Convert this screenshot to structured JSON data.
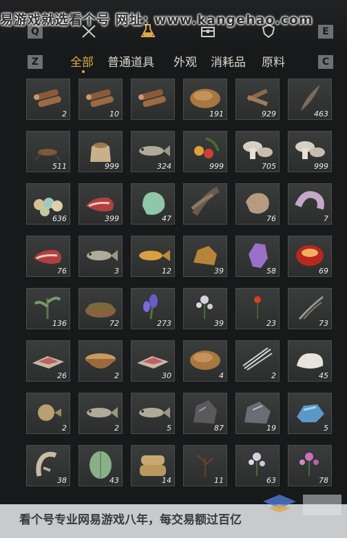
{
  "watermark_top": "易游戏就选看个号  网址: www.kangehao.com",
  "watermark_bottom": "看个号专业网易游戏八年，每交易额过百亿",
  "watermark_url": "www.kangehao.com",
  "keys": {
    "top_left": "Q",
    "top_right": "E",
    "tab_left": "Z",
    "tab_right": "C"
  },
  "top_icons": [
    "crossed-swords-icon",
    "flask-icon",
    "chest-icon",
    "shield-icon"
  ],
  "tabs": [
    {
      "label": "全部",
      "active": true
    },
    {
      "label": "普通道具",
      "active": false
    },
    {
      "label": "外观",
      "active": false
    },
    {
      "label": "消耗品",
      "active": false
    },
    {
      "label": "原料",
      "active": false
    }
  ],
  "items": [
    [
      {
        "icon": "wood-log",
        "count": "2"
      },
      {
        "icon": "wood-log",
        "count": "10"
      },
      {
        "icon": "wood-log",
        "count": ""
      },
      {
        "icon": "fiber-bundle",
        "count": "191"
      },
      {
        "icon": "branch-pile",
        "count": "929"
      },
      {
        "icon": "feather",
        "count": "463"
      }
    ],
    [
      {
        "icon": "cricket",
        "count": "511"
      },
      {
        "icon": "grain-sack",
        "count": "999"
      },
      {
        "icon": "fish",
        "count": "324"
      },
      {
        "icon": "berry-branch",
        "count": "999"
      },
      {
        "icon": "mushroom",
        "count": "705"
      },
      {
        "icon": "mushroom",
        "count": "999"
      }
    ],
    [
      {
        "icon": "eggs",
        "count": "636"
      },
      {
        "icon": "raw-meat",
        "count": "399"
      },
      {
        "icon": "jade-stone",
        "count": "47"
      },
      {
        "icon": "feathers",
        "count": ""
      },
      {
        "icon": "hide",
        "count": "76"
      },
      {
        "icon": "pelt",
        "count": "7"
      }
    ],
    [
      {
        "icon": "raw-meat",
        "count": "76"
      },
      {
        "icon": "fish",
        "count": "3"
      },
      {
        "icon": "golden-carp",
        "count": "12"
      },
      {
        "icon": "ore-chunk",
        "count": "39"
      },
      {
        "icon": "amethyst",
        "count": "58"
      },
      {
        "icon": "red-agate",
        "count": "69"
      }
    ],
    [
      {
        "icon": "herb",
        "count": "136"
      },
      {
        "icon": "herb-bowl",
        "count": "72"
      },
      {
        "icon": "lavender",
        "count": "273"
      },
      {
        "icon": "white-flower",
        "count": "39"
      },
      {
        "icon": "red-flower",
        "count": "23"
      },
      {
        "icon": "dry-grass",
        "count": "73"
      }
    ],
    [
      {
        "icon": "meat-slice",
        "count": "26"
      },
      {
        "icon": "soup-bowl",
        "count": "2"
      },
      {
        "icon": "meat-slice",
        "count": "30"
      },
      {
        "icon": "fiber-bundle",
        "count": "4"
      },
      {
        "icon": "quills",
        "count": "2"
      },
      {
        "icon": "fleece",
        "count": "45"
      }
    ],
    [
      {
        "icon": "pufferfish",
        "count": "2"
      },
      {
        "icon": "fish",
        "count": "2"
      },
      {
        "icon": "fish",
        "count": "5"
      },
      {
        "icon": "iron-ore",
        "count": "87"
      },
      {
        "icon": "silver-ore",
        "count": "19"
      },
      {
        "icon": "blue-crystal",
        "count": "5"
      }
    ],
    [
      {
        "icon": "root",
        "count": "38"
      },
      {
        "icon": "melon",
        "count": "43"
      },
      {
        "icon": "rice-sack",
        "count": "14"
      },
      {
        "icon": "dead-herb",
        "count": "11"
      },
      {
        "icon": "white-flower",
        "count": "63"
      },
      {
        "icon": "purple-flower",
        "count": "78"
      }
    ]
  ],
  "colors": {
    "accent": "#e0a84a",
    "background": "#17191a",
    "slot": "#353837"
  }
}
